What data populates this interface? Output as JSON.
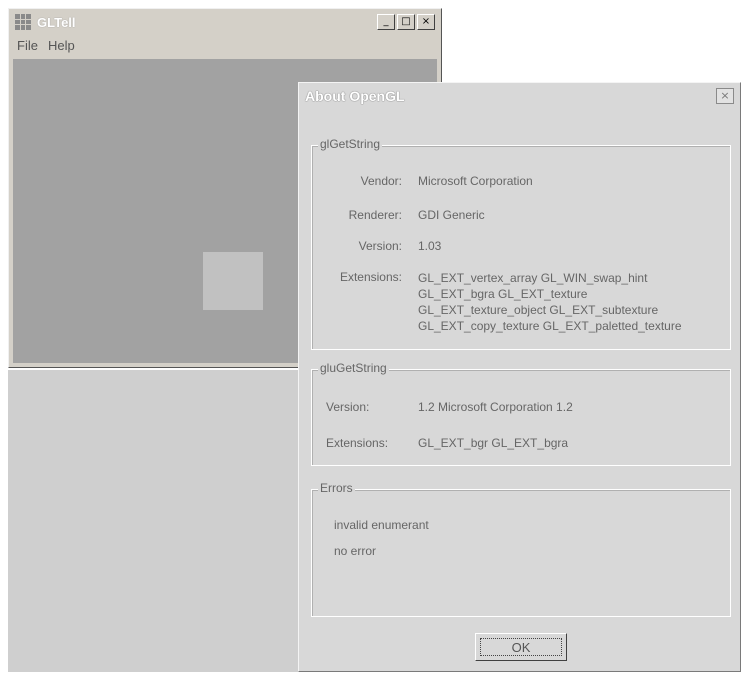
{
  "main_window": {
    "title": "GLTell",
    "buttons": {
      "minimize": "_",
      "maximize": "□",
      "close": "×"
    },
    "menu": [
      "File",
      "Help"
    ]
  },
  "dialog": {
    "title": "About OpenGL",
    "close": "×",
    "gl_group": {
      "legend": "glGetString",
      "vendor_label": "Vendor:",
      "vendor": "Microsoft Corporation",
      "renderer_label": "Renderer:",
      "renderer": "GDI Generic",
      "version_label": "Version:",
      "version": "1.03",
      "extensions_label": "Extensions:",
      "extensions": [
        "GL_EXT_vertex_array GL_WIN_swap_hint",
        "GL_EXT_bgra GL_EXT_texture",
        "GL_EXT_texture_object GL_EXT_subtexture",
        "GL_EXT_copy_texture GL_EXT_paletted_texture"
      ]
    },
    "glu_group": {
      "legend": "gluGetString",
      "version_label": "Version:",
      "version": "1.2 Microsoft Corporation 1.2",
      "extensions_label": "Extensions:",
      "extensions": "GL_EXT_bgr GL_EXT_bgra"
    },
    "errors_group": {
      "legend": "Errors",
      "items": [
        "invalid enumerant",
        "no error"
      ]
    },
    "ok_label": "OK"
  }
}
